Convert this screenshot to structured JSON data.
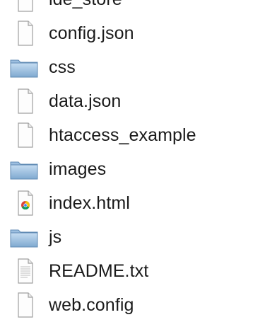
{
  "files": [
    {
      "name": "ide_store",
      "icon": "document-icon"
    },
    {
      "name": "config.json",
      "icon": "document-icon"
    },
    {
      "name": "css",
      "icon": "folder-icon"
    },
    {
      "name": "data.json",
      "icon": "document-icon"
    },
    {
      "name": "htaccess_example",
      "icon": "document-icon"
    },
    {
      "name": "images",
      "icon": "folder-icon"
    },
    {
      "name": "index.html",
      "icon": "html-document-icon"
    },
    {
      "name": "js",
      "icon": "folder-icon"
    },
    {
      "name": "README.txt",
      "icon": "text-document-icon"
    },
    {
      "name": "web.config",
      "icon": "document-icon"
    }
  ],
  "colors": {
    "folder_top": "#c6ddf2",
    "folder_bottom": "#7fa9d0",
    "folder_edge": "#5f8ab3",
    "document_fill": "#fdfdfd",
    "document_edge": "#a0a0a0",
    "text": "#1a1a1a"
  }
}
